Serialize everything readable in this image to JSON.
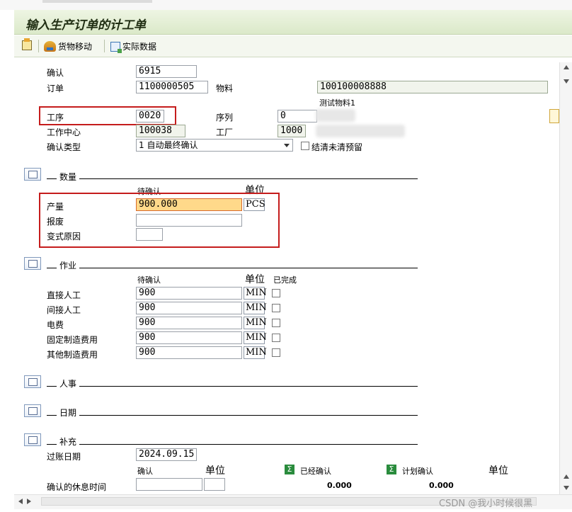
{
  "title": "输入生产订单的计工单",
  "toolbar": {
    "goods_movement": "货物移动",
    "actual_data": "实际数据"
  },
  "header_fields": {
    "confirmation": {
      "label": "确认",
      "value": "6915"
    },
    "order": {
      "label": "订单",
      "value": "1100000505"
    },
    "material": {
      "label": "物料",
      "value": "100100008888"
    },
    "material_desc": "测试物料1",
    "operation": {
      "label": "工序",
      "value": "0020"
    },
    "sequence": {
      "label": "序列",
      "value": "0"
    },
    "work_center": {
      "label": "工作中心",
      "value": "100038"
    },
    "plant": {
      "label": "工厂",
      "value": "1000"
    },
    "conf_type": {
      "label": "确认类型",
      "value": "1 自动最终确认"
    },
    "clear_reservation": "结清未清预留"
  },
  "quantity": {
    "group_title": "数量",
    "col_to_confirm": "待确认",
    "col_unit": "单位",
    "yield": {
      "label": "产量",
      "value": "900.000",
      "unit": "PCS"
    },
    "scrap": {
      "label": "报废",
      "value": ""
    },
    "variance_reason": {
      "label": "变式原因",
      "value": ""
    }
  },
  "activities": {
    "group_title": "作业",
    "col_to_confirm": "待确认",
    "col_unit": "单位",
    "col_done": "已完成",
    "rows": [
      {
        "label": "直接人工",
        "value": "900",
        "unit": "MIN"
      },
      {
        "label": "间接人工",
        "value": "900",
        "unit": "MIN"
      },
      {
        "label": "电费",
        "value": "900",
        "unit": "MIN"
      },
      {
        "label": "固定制造费用",
        "value": "900",
        "unit": "MIN"
      },
      {
        "label": "其他制造费用",
        "value": "900",
        "unit": "MIN"
      }
    ]
  },
  "personnel": {
    "group_title": "人事"
  },
  "dates": {
    "group_title": "日期"
  },
  "supplement": {
    "group_title": "补充",
    "posting_date": {
      "label": "过账日期",
      "value": "2024.09.15"
    },
    "col_confirm": "确认",
    "col_unit": "单位",
    "col_confirmed": "已经确认",
    "col_planned": "计划确认",
    "col_unit2": "单位",
    "break_time": {
      "label": "确认的休息时间",
      "confirmed": "0.000",
      "planned": "0.000"
    }
  },
  "watermark": "CSDN @我小时候很黑"
}
